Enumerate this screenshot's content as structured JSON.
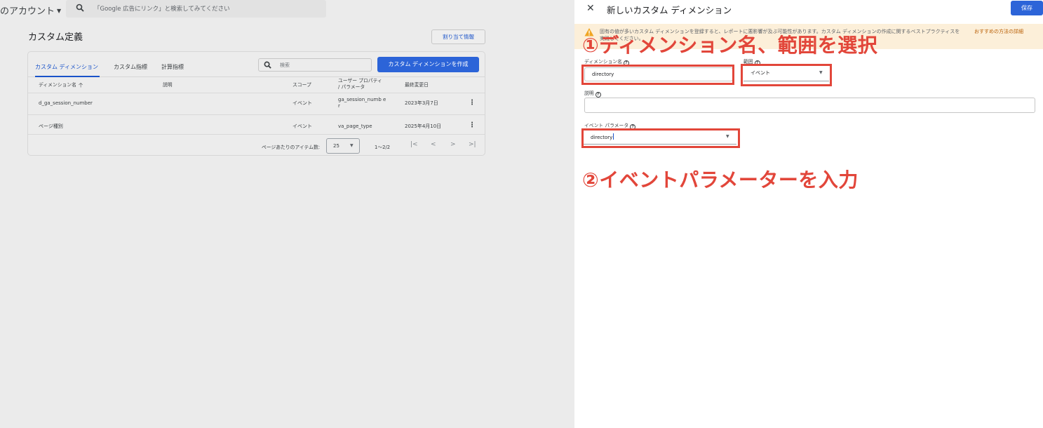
{
  "header": {
    "account_label": "のアカウント",
    "search_placeholder": "「Google 広告にリンク」と検索してみてください"
  },
  "page": {
    "title": "カスタム定義",
    "assign_button": "割り当て情報"
  },
  "tabs": [
    {
      "label": "カスタム ディメンション",
      "active": true
    },
    {
      "label": "カスタム指標",
      "active": false
    },
    {
      "label": "計算指標",
      "active": false
    }
  ],
  "table_search_placeholder": "検索",
  "create_button": "カスタム ディメンションを作成",
  "table": {
    "columns": [
      "ディメンション名",
      "説明",
      "スコープ",
      "ユーザー プロパティ / パラメータ",
      "最終変更日"
    ],
    "rows": [
      {
        "name": "d_ga_session_number",
        "description": "",
        "scope": "イベント",
        "param": "ga_session_numb er",
        "modified": "2023年3月7日"
      },
      {
        "name": "ページ種別",
        "description": "",
        "scope": "イベント",
        "param": "va_page_type",
        "modified": "2025年4月10日"
      }
    ]
  },
  "pagination": {
    "items_per_page_label": "ページあたりのアイテム数:",
    "items_per_page": "25",
    "range": "1～2/2"
  },
  "panel": {
    "title": "新しいカスタム ディメンション",
    "save_button": "保存",
    "warning_text": "固有の値が多いカスタム ディメンションを登録すると、レポートに悪影響が及ぶ可能性があります。カスタム ディメンションの作成に関するベストプラクティスを実践してください。",
    "warning_link": "おすすめの方法の詳細",
    "dimension_name_label": "ディメンション名",
    "dimension_name_value": "directory",
    "scope_label": "範囲",
    "scope_value": "イベント",
    "description_label": "説明",
    "description_value": "",
    "event_param_label": "イベント パラメータ",
    "event_param_value": "directory"
  },
  "annotations": {
    "step1": "①ディメンション名、範囲を選択",
    "step2": "②イベントパラメーターを入力"
  },
  "colors": {
    "accent_blue": "#2c64d8",
    "annotation_red": "#e2463a",
    "warning_bg": "#fcefd9"
  }
}
